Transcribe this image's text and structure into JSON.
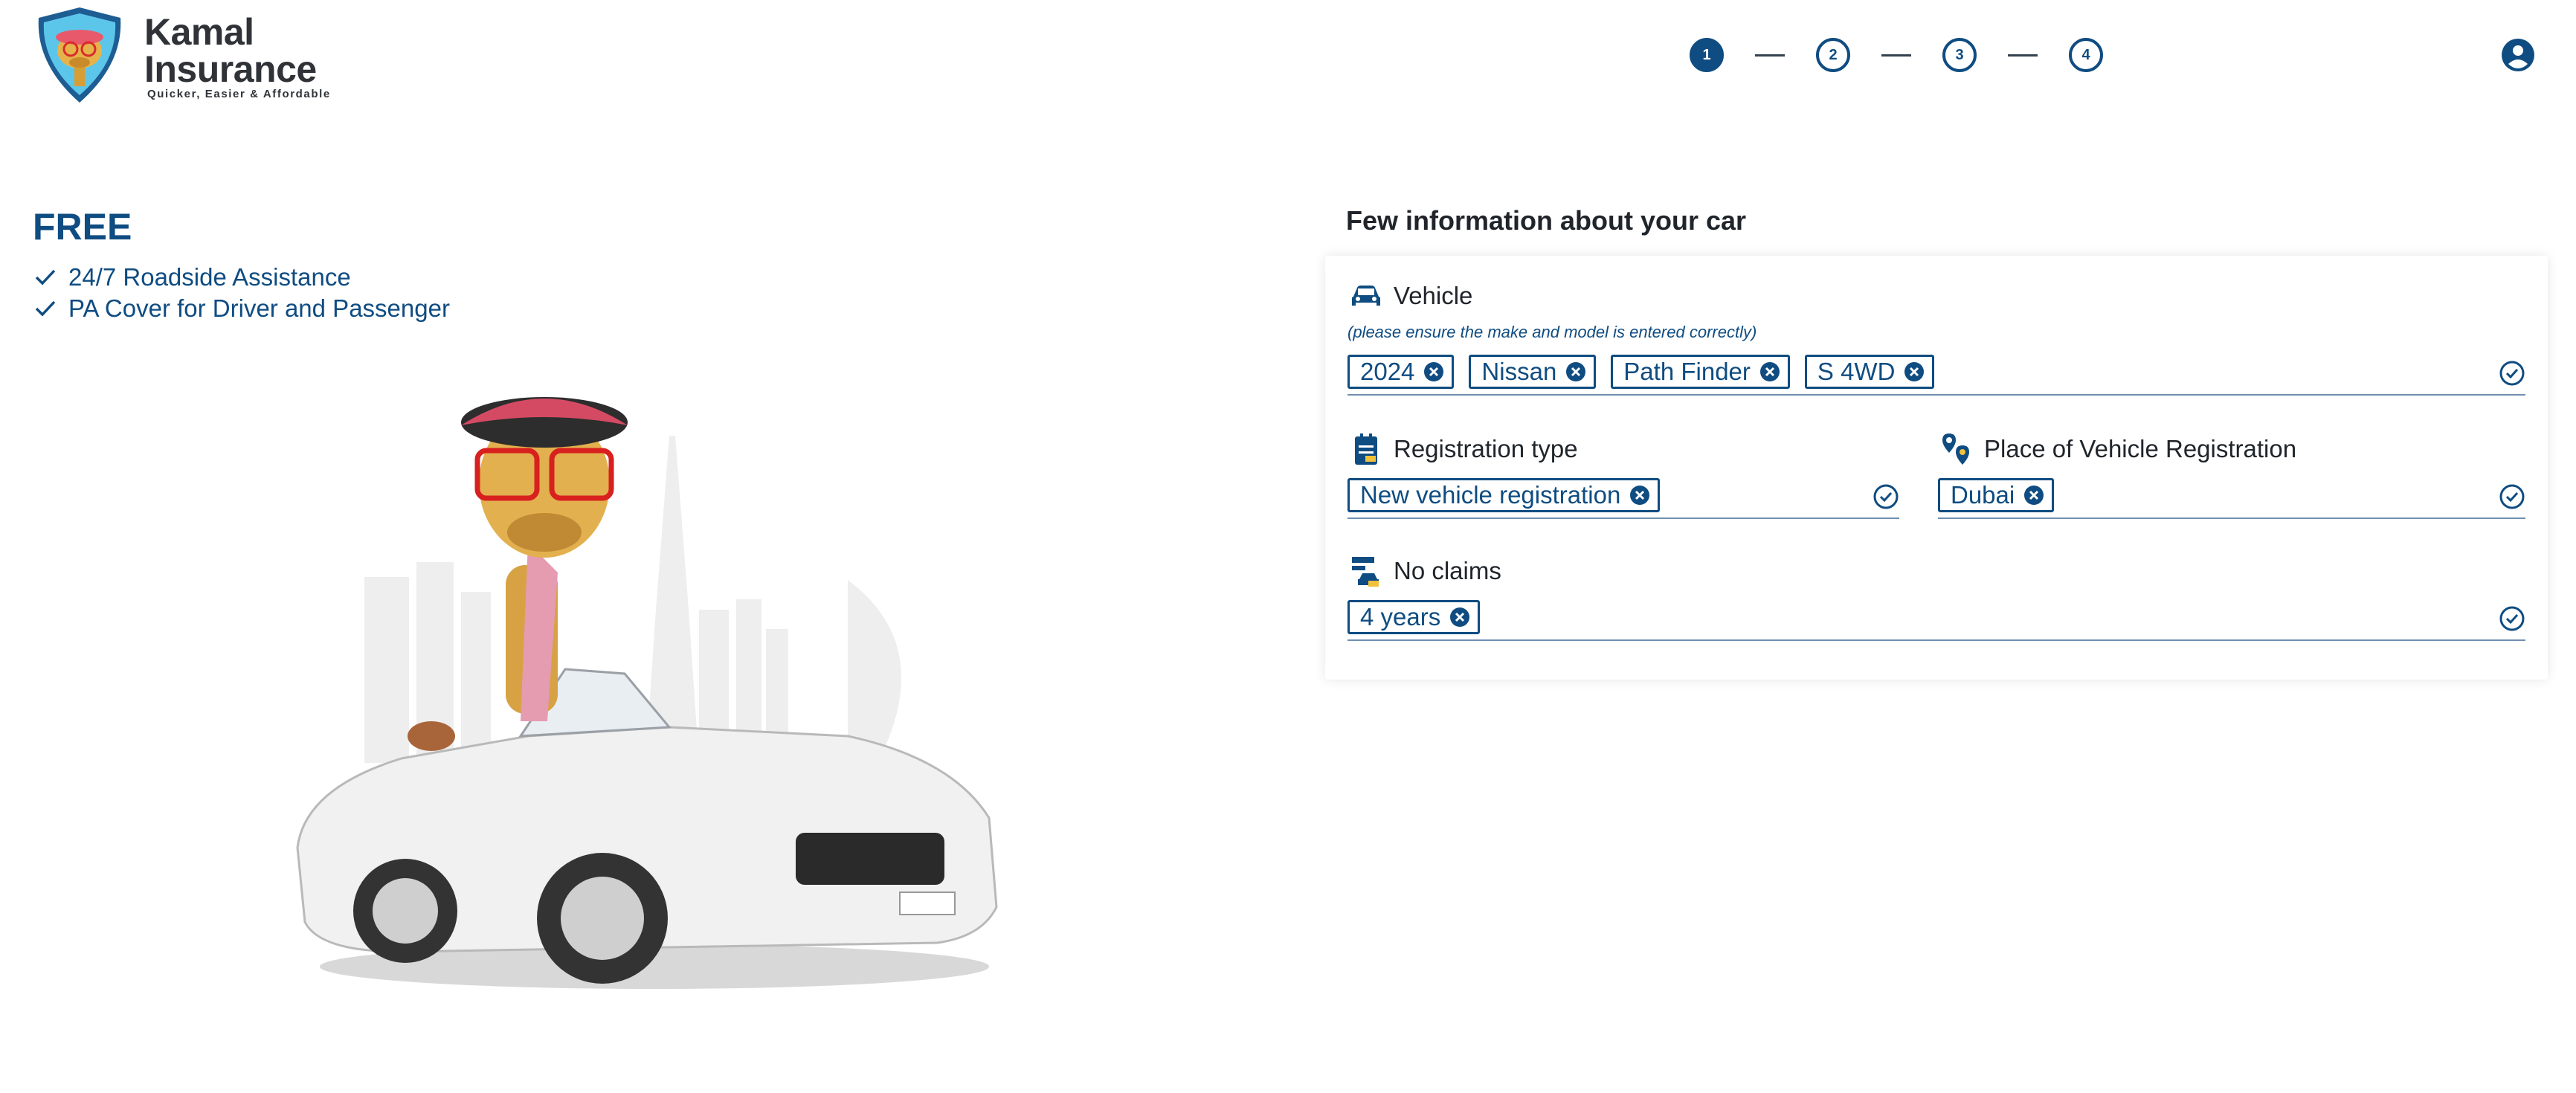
{
  "brand": {
    "name_line1": "Kamal",
    "name_line2": "Insurance",
    "tagline": "Quicker, Easier & Affordable"
  },
  "stepper": {
    "steps": [
      "1",
      "2",
      "3",
      "4"
    ],
    "active": 1
  },
  "promo": {
    "title": "FREE",
    "benefits": [
      "24/7 Roadside Assistance",
      "PA Cover for Driver and Passenger"
    ]
  },
  "form": {
    "title": "Few information about your car",
    "vehicle": {
      "label": "Vehicle",
      "hint": "(please ensure the make and model is entered correctly)",
      "chips": [
        "2024",
        "Nissan",
        "Path Finder",
        "S 4WD"
      ]
    },
    "registration_type": {
      "label": "Registration type",
      "chips": [
        "New vehicle registration"
      ]
    },
    "place_of_registration": {
      "label": "Place of Vehicle Registration",
      "chips": [
        "Dubai"
      ]
    },
    "no_claims": {
      "label": "No claims",
      "chips": [
        "4 years"
      ]
    }
  },
  "icons": {
    "check": "check-icon",
    "remove": "close-circle-icon",
    "valid": "check-circle-icon",
    "account": "user-account-icon"
  },
  "colors": {
    "primary": "#0f4c81",
    "text": "#20252b"
  }
}
